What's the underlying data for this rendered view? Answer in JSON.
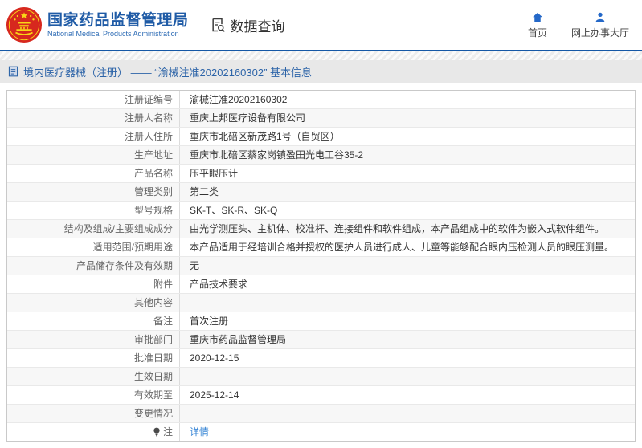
{
  "header": {
    "title": "国家药品监督管理局",
    "subtitle": "National Medical Products Administration",
    "data_query_label": "数据查询",
    "nav": [
      {
        "label": "首页",
        "icon": "home-icon"
      },
      {
        "label": "网上办事大厅",
        "icon": "user-icon"
      }
    ]
  },
  "breadcrumb": {
    "text": "境内医疗器械（注册） —— “渝械注准20202160302” 基本信息"
  },
  "colors": {
    "brand_blue": "#1f5ba6",
    "header_line_blue": "#1558a6",
    "nav_icon_blue": "#2468c8",
    "link_blue": "#3a87d6",
    "emblem_red": "#d7281e",
    "emblem_yellow": "#f9d616",
    "breadcrumb_bg": "#e8e8e8",
    "row_alt_bg": "#f7f7f7"
  },
  "table": {
    "rows": [
      {
        "label": "注册证编号",
        "value": "渝械注准20202160302"
      },
      {
        "label": "注册人名称",
        "value": "重庆上邦医疗设备有限公司"
      },
      {
        "label": "注册人住所",
        "value": "重庆市北碚区新茂路1号（自贸区）"
      },
      {
        "label": "生产地址",
        "value": "重庆市北碚区蔡家岗镇盈田光电工谷35-2"
      },
      {
        "label": "产品名称",
        "value": "压平眼压计"
      },
      {
        "label": "管理类别",
        "value": "第二类"
      },
      {
        "label": "型号规格",
        "value": "SK-T、SK-R、SK-Q"
      },
      {
        "label": "结构及组成/主要组成成分",
        "value": "由光学测压头、主机体、校准杆、连接组件和软件组成，本产品组成中的软件为嵌入式软件组件。"
      },
      {
        "label": "适用范围/预期用途",
        "value": "本产品适用于经培训合格并授权的医护人员进行成人、儿童等能够配合眼内压检测人员的眼压测量。"
      },
      {
        "label": "产品储存条件及有效期",
        "value": "无"
      },
      {
        "label": "附件",
        "value": "产品技术要求"
      },
      {
        "label": "其他内容",
        "value": ""
      },
      {
        "label": "备注",
        "value": "首次注册"
      },
      {
        "label": "审批部门",
        "value": "重庆市药品监督管理局"
      },
      {
        "label": "批准日期",
        "value": "2020-12-15"
      },
      {
        "label": "生效日期",
        "value": ""
      },
      {
        "label": "有效期至",
        "value": "2025-12-14"
      },
      {
        "label": "变更情况",
        "value": ""
      },
      {
        "label": "注",
        "label_icon": "note-icon",
        "value": "详情",
        "value_is_link": true
      }
    ]
  }
}
